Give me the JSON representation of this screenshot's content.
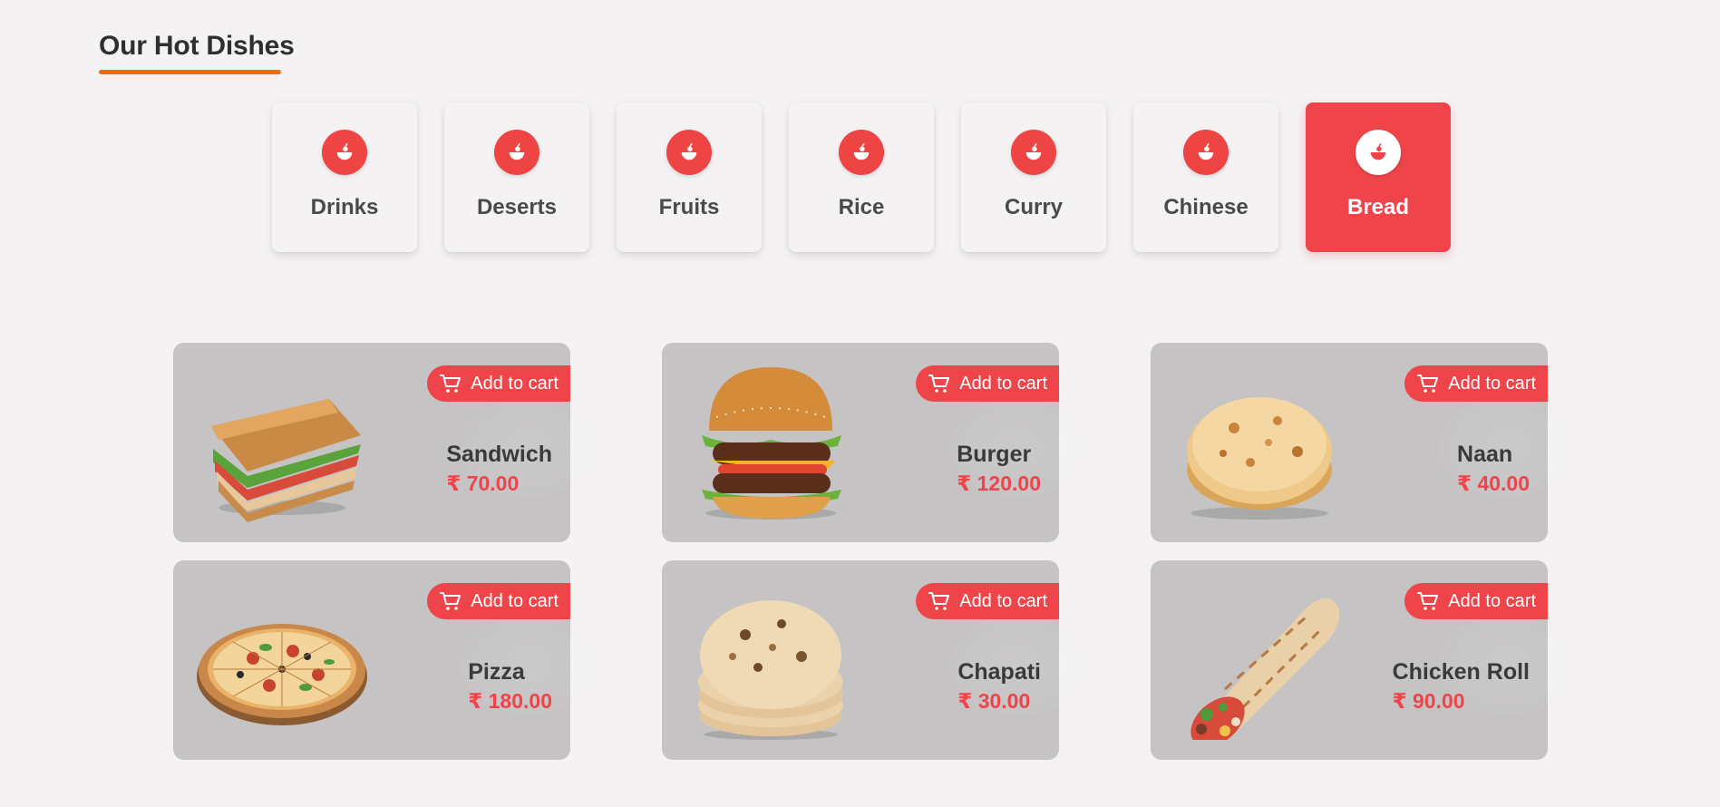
{
  "section": {
    "title": "Our Hot Dishes"
  },
  "categories": [
    {
      "label": "Drinks",
      "icon": "food-bowl-icon",
      "active": false
    },
    {
      "label": "Deserts",
      "icon": "food-bowl-icon",
      "active": false
    },
    {
      "label": "Fruits",
      "icon": "food-bowl-icon",
      "active": false
    },
    {
      "label": "Rice",
      "icon": "food-bowl-icon",
      "active": false
    },
    {
      "label": "Curry",
      "icon": "food-bowl-icon",
      "active": false
    },
    {
      "label": "Chinese",
      "icon": "food-bowl-icon",
      "active": false
    },
    {
      "label": "Bread",
      "icon": "food-bowl-icon",
      "active": true
    }
  ],
  "dishes": [
    {
      "name": "Sandwich",
      "price": "₹ 70.00",
      "cart_label": "Add to cart",
      "image": "sandwich-image"
    },
    {
      "name": "Burger",
      "price": "₹ 120.00",
      "cart_label": "Add to cart",
      "image": "burger-image"
    },
    {
      "name": "Naan",
      "price": "₹ 40.00",
      "cart_label": "Add to cart",
      "image": "naan-image"
    },
    {
      "name": "Pizza",
      "price": "₹ 180.00",
      "cart_label": "Add to cart",
      "image": "pizza-image"
    },
    {
      "name": "Chapati",
      "price": "₹ 30.00",
      "cart_label": "Add to cart",
      "image": "chapati-image"
    },
    {
      "name": "Chicken Roll",
      "price": "₹ 90.00",
      "cart_label": "Add to cart",
      "image": "chicken-roll-image"
    }
  ],
  "colors": {
    "accent": "#ef444a",
    "underline": "#f06a16",
    "card_bg": "#c5c3c4",
    "page_bg": "#f4f2f3"
  }
}
